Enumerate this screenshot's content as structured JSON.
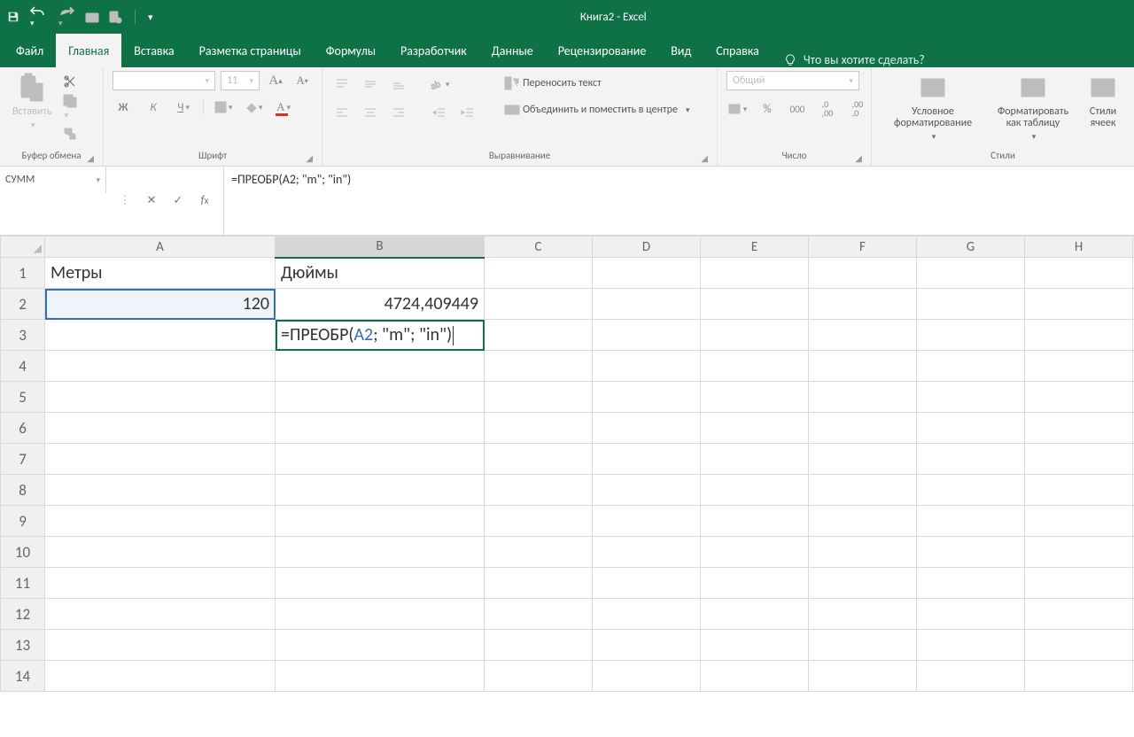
{
  "app": {
    "title": "Книга2  -  Excel"
  },
  "qat": {
    "save": "save",
    "undo": "undo",
    "redo": "redo"
  },
  "tabs": {
    "file": "Файл",
    "items": [
      "Главная",
      "Вставка",
      "Разметка страницы",
      "Формулы",
      "Разработчик",
      "Данные",
      "Рецензирование",
      "Вид",
      "Справка"
    ],
    "active": 0,
    "tellme": "Что вы хотите сделать?"
  },
  "ribbon": {
    "clipboard": {
      "paste": "Вставить",
      "label": "Буфер обмена"
    },
    "font": {
      "name_placeholder": "",
      "size": "11",
      "bold": "Ж",
      "italic": "К",
      "underline": "Ч",
      "label": "Шрифт"
    },
    "align": {
      "wrap": "Переносить текст",
      "merge": "Объединить и поместить в центре",
      "label": "Выравнивание"
    },
    "number": {
      "format": "Общий",
      "label": "Число"
    },
    "styles": {
      "conditional": "Условное форматирование",
      "astable": "Форматировать как таблицу",
      "cellstyles": "Стили ячеек",
      "label": "Стили"
    }
  },
  "formula_bar": {
    "name": "СУММ",
    "formula": "=ПРЕОБР(A2; \"m\"; \"in\")"
  },
  "sheet": {
    "columns": [
      "A",
      "B",
      "C",
      "D",
      "E",
      "F",
      "G",
      "H"
    ],
    "rows": 14,
    "cells": {
      "A1": "Метры",
      "B1": "Дюймы",
      "A2": "120",
      "B2": "4724,409449",
      "B3_prefix": "=ПРЕОБР(",
      "B3_ref": "A2",
      "B3_suffix": "; \"m\"; \"in\")"
    },
    "editing": "B3",
    "ref_highlight": "A2"
  }
}
